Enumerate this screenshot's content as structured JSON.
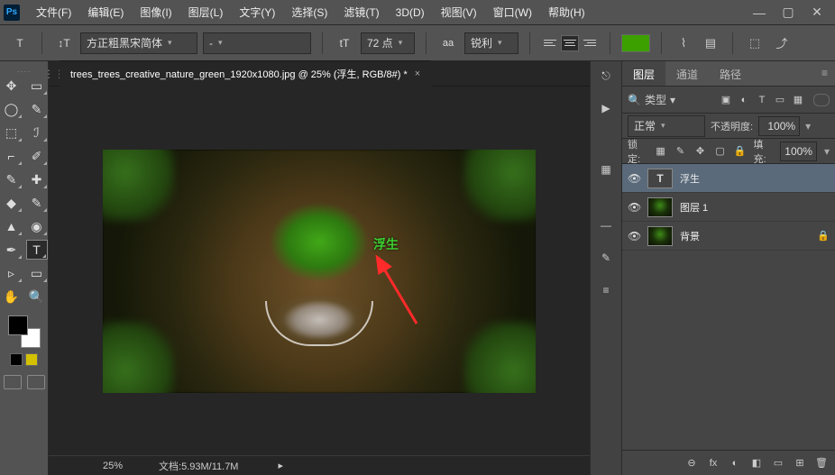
{
  "app_logo": "Ps",
  "menu": [
    "文件(F)",
    "编辑(E)",
    "图像(I)",
    "图层(L)",
    "文字(Y)",
    "选择(S)",
    "滤镜(T)",
    "3D(D)",
    "视图(V)",
    "窗口(W)",
    "帮助(H)"
  ],
  "options": {
    "tool_glyph": "T",
    "font_family": "方正粗黑宋简体",
    "font_style": "-",
    "size_glyph": "tT",
    "font_size": "72 点",
    "aa_glyph": "aa",
    "antialias": "锐利",
    "color": "#3ca000",
    "align_active": 1
  },
  "document": {
    "tab_title": "trees_trees_creative_nature_green_1920x1080.jpg @ 25% (浮生, RGB/8#) *",
    "canvas_text": "浮生",
    "zoom": "25%",
    "doc_info": "文档:5.93M/11.7M"
  },
  "panels": {
    "tabs": [
      "图层",
      "通道",
      "路径"
    ],
    "active_tab": 0,
    "filter_label": "类型",
    "blend_mode": "正常",
    "opacity_label": "不透明度:",
    "opacity_value": "100%",
    "lock_label": "锁定:",
    "fill_label": "填充:",
    "fill_value": "100%",
    "layers": [
      {
        "name": "浮生",
        "type": "text",
        "selected": true,
        "locked": false
      },
      {
        "name": "图层 1",
        "type": "image",
        "selected": false,
        "locked": false
      },
      {
        "name": "背景",
        "type": "image",
        "selected": false,
        "locked": true
      }
    ],
    "footer_icons": [
      "⊖",
      "fx",
      "◐",
      "◧",
      "▭",
      "⊞",
      "🗑"
    ]
  },
  "strip_icons": [
    "⎋",
    "▶",
    "▦",
    "—",
    "✎",
    "≡"
  ],
  "tools": [
    "✥",
    "▭",
    "◯",
    "✎",
    "⬚",
    "ℐ",
    "⌐",
    "✐",
    "✎",
    "✚",
    "◆",
    "✎",
    "▲",
    "◉",
    "✒",
    "T",
    "▹",
    "▭",
    "✋",
    "🔍"
  ]
}
